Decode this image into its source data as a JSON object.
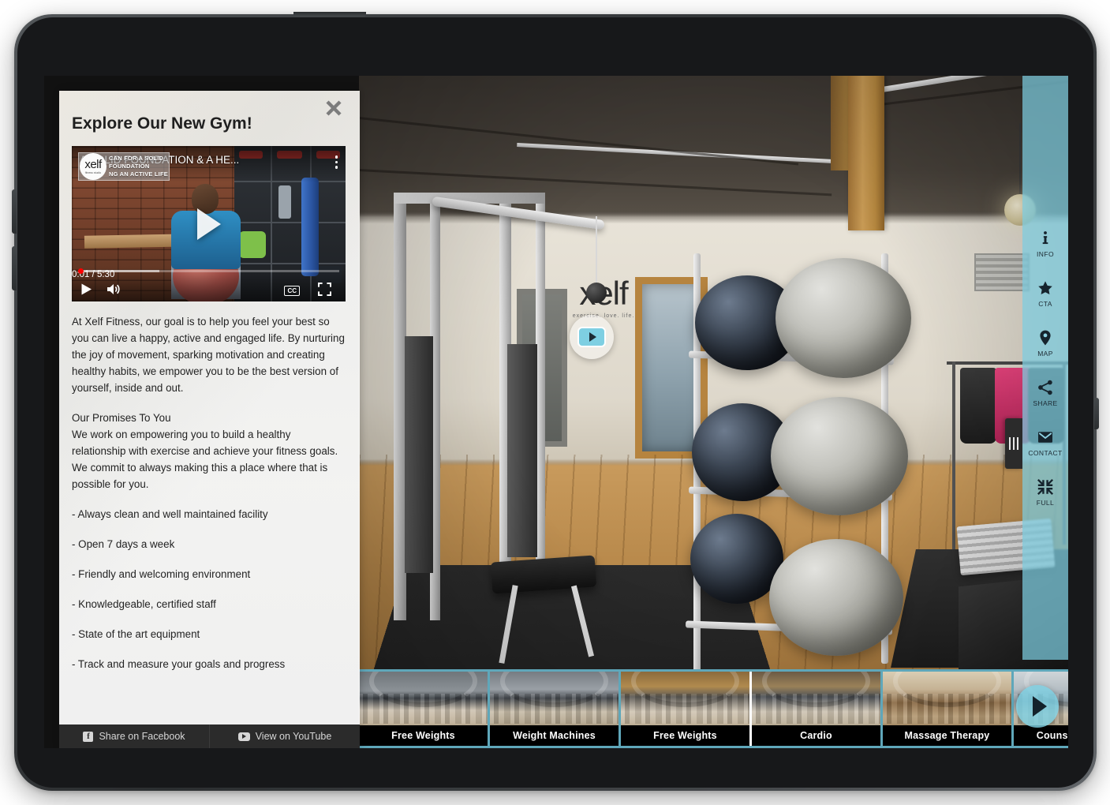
{
  "device": {
    "type": "tablet"
  },
  "info_panel": {
    "title": "Explore Our New Gym!",
    "close_icon": "close-icon",
    "video": {
      "title": "A SOLID FOUNDATION & A HE...",
      "watermark_word": "xelf",
      "watermark_sub": "fitness studio",
      "watermark_line1": "CAN FOR A SOLID FOUNDATION",
      "watermark_line2": "NG AN ACTIVE LIFE",
      "current_time": "0:01",
      "duration": "5:30",
      "time_display": "0:01 / 5:30",
      "play_label": "play-button",
      "volume_label": "volume-button",
      "cc_label": "CC",
      "fullscreen_label": "fullscreen-button",
      "more_label": "more-options"
    },
    "paragraphs": [
      "At Xelf Fitness, our goal is to help you feel your best so you can live a happy, active and engaged life. By nurturing the joy of movement, sparking motivation and creating healthy habits, we empower you to be the best version of yourself, inside and out."
    ],
    "promises_heading": "Our Promises To You",
    "promises_text": "We work on empowering you to build a healthy relationship with exercise and achieve your fitness goals. We commit to always making this a place where that is possible for you.",
    "bullets": [
      "- Always clean and well maintained facility",
      "- Open 7 days a week",
      "- Friendly and welcoming environment",
      "- Knowledgeable, certified staff",
      "- State of the art equipment",
      "- Track and measure your goals and progress"
    ],
    "footer": {
      "facebook_label": "Share on Facebook",
      "facebook_icon": "facebook-icon",
      "youtube_label": "View on YouTube",
      "youtube_icon": "youtube-icon"
    }
  },
  "tour": {
    "hotspot": {
      "name": "video-hotspot"
    },
    "toolbar": {
      "accent_color": "#7dcde0",
      "items": [
        {
          "label": "INFO",
          "icon": "info-icon"
        },
        {
          "label": "CTA",
          "icon": "star-icon"
        },
        {
          "label": "MAP",
          "icon": "map-pin-icon"
        },
        {
          "label": "SHARE",
          "icon": "share-icon"
        },
        {
          "label": "CONTACT",
          "icon": "envelope-icon"
        },
        {
          "label": "FULL",
          "icon": "fullscreen-collapse-icon"
        }
      ],
      "handle": "toolbar-collapse-handle"
    },
    "filmstrip": {
      "background_color": "#5fa7ba",
      "next_icon": "chevron-right-icon",
      "thumbnails": [
        {
          "label": "Free Weights",
          "active": false,
          "scene": "sc-gym1"
        },
        {
          "label": "Weight Machines",
          "active": false,
          "scene": "sc-gym2"
        },
        {
          "label": "Free Weights",
          "active": true,
          "scene": "sc-gym3"
        },
        {
          "label": "Cardio",
          "active": false,
          "scene": "sc-gym4"
        },
        {
          "label": "Massage Therapy",
          "active": false,
          "scene": "sc-mass"
        },
        {
          "label": "Counselling Area",
          "active": false,
          "scene": "sc-couns"
        }
      ]
    },
    "wall_sign": {
      "word": "xelf",
      "tagline": "exercise. love. life."
    }
  }
}
